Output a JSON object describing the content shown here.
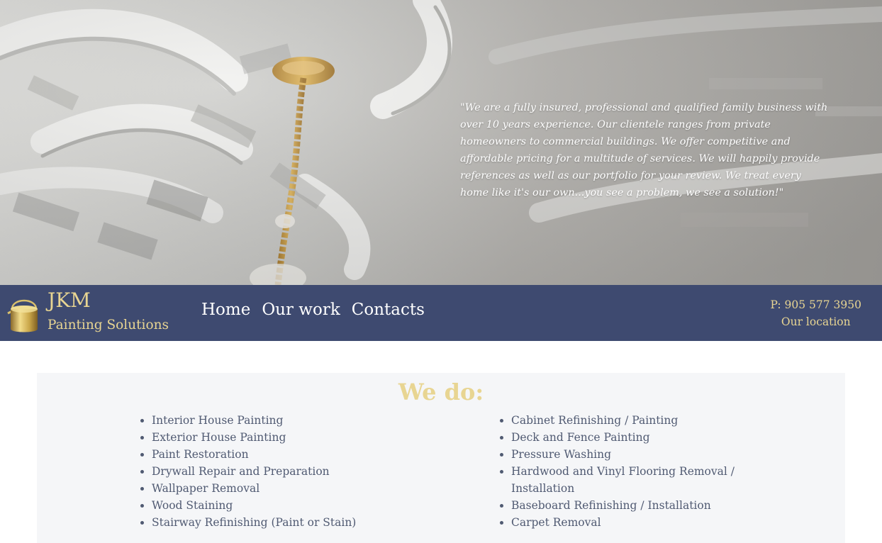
{
  "hero": {
    "quote": "\"We are a fully insured, professional and qualified family business with over 10 years experience. Our clientele ranges from private homeowners to commercial buildings. We offer competitive and affordable pricing for a multitude of services. We will happily provide references as well as our portfolio for your review. We treat every home like it's our own...you see a problem, we see a solution!\""
  },
  "brand": {
    "name": "JKM",
    "tagline": "Painting Solutions",
    "logo_icon": "paint-can-icon"
  },
  "nav": {
    "items": [
      {
        "label": "Home"
      },
      {
        "label": "Our work"
      },
      {
        "label": "Contacts"
      }
    ]
  },
  "contact": {
    "phone": "P: 905 577 3950",
    "location": "Our location"
  },
  "services": {
    "title": "We do:",
    "left": [
      "Interior House Painting",
      "Exterior House Painting",
      "Paint Restoration",
      "Drywall Repair and Preparation",
      "Wallpaper Removal",
      "Wood Staining",
      "Stairway Refinishing (Paint or Stain)"
    ],
    "right": [
      "Cabinet Refinishing / Painting",
      "Deck and Fence Painting",
      "Pressure Washing",
      "Hardwood and Vinyl Flooring Removal / Installation",
      "Baseboard Refinishing / Installation",
      "Carpet Removal"
    ]
  },
  "colors": {
    "navbar": "#3e4a70",
    "accent_gold": "#e8d592",
    "text_dark": "#505a72",
    "panel_bg": "#f5f6f8"
  }
}
